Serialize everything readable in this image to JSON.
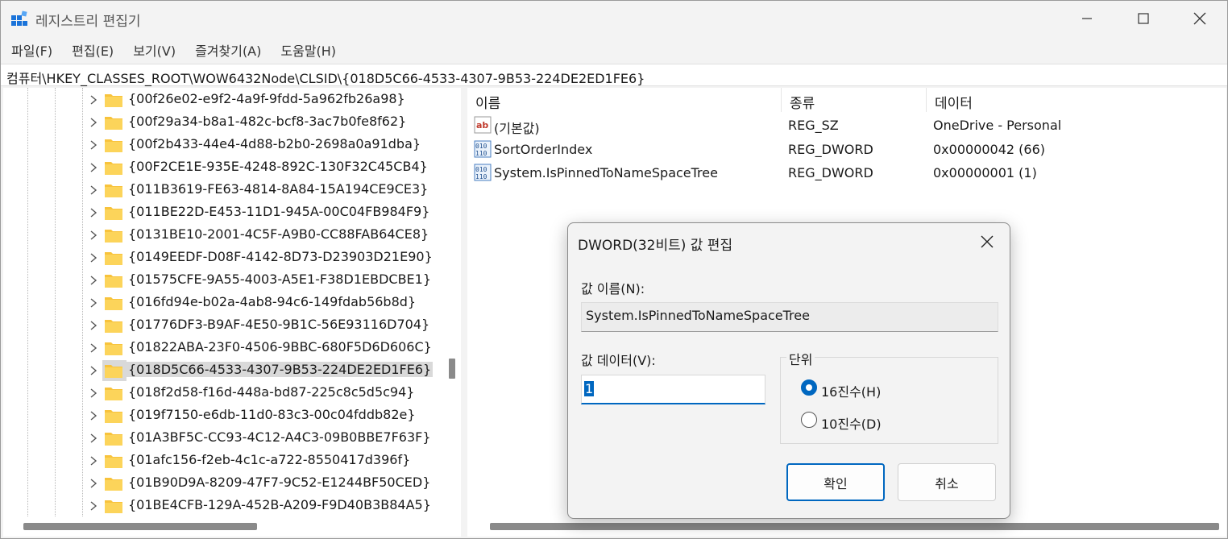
{
  "window": {
    "title": "레지스트리 편집기"
  },
  "menu": [
    "파일(F)",
    "편집(E)",
    "보기(V)",
    "즐겨찾기(A)",
    "도움말(H)"
  ],
  "address": "컴퓨터\\HKEY_CLASSES_ROOT\\WOW6432Node\\CLSID\\{018D5C66-4533-4307-9B53-224DE2ED1FE6}",
  "tree": {
    "items": [
      "{00f26e02-e9f2-4a9f-9fdd-5a962fb26a98}",
      "{00f29a34-b8a1-482c-bcf8-3ac7b0fe8f62}",
      "{00f2b433-44e4-4d88-b2b0-2698a0a91dba}",
      "{00F2CE1E-935E-4248-892C-130F32C45CB4}",
      "{011B3619-FE63-4814-8A84-15A194CE9CE3}",
      "{011BE22D-E453-11D1-945A-00C04FB984F9}",
      "{0131BE10-2001-4C5F-A9B0-CC88FAB64CE8}",
      "{0149EEDF-D08F-4142-8D73-D23903D21E90}",
      "{01575CFE-9A55-4003-A5E1-F38D1EBDCBE1}",
      "{016fd94e-b02a-4ab8-94c6-149fdab56b8d}",
      "{01776DF3-B9AF-4E50-9B1C-56E93116D704}",
      "{01822ABA-23F0-4506-9BBC-680F5D6D606C}",
      "{018D5C66-4533-4307-9B53-224DE2ED1FE6}",
      "{018f2d58-f16d-448a-bd87-225c8c5d5c94}",
      "{019f7150-e6db-11d0-83c3-00c04fddb82e}",
      "{01A3BF5C-CC93-4C12-A4C3-09B0BBE7F63F}",
      "{01afc156-f2eb-4c1c-a722-8550417d396f}",
      "{01B90D9A-8209-47F7-9C52-E1244BF50CED}",
      "{01BE4CFB-129A-452B-A209-F9D40B3B84A5}"
    ],
    "selected_index": 12
  },
  "values": {
    "headers": {
      "name": "이름",
      "type": "종류",
      "data": "데이터"
    },
    "rows": [
      {
        "icon": "string-value-icon",
        "name": "(기본값)",
        "type": "REG_SZ",
        "data": "OneDrive - Personal"
      },
      {
        "icon": "binary-value-icon",
        "name": "SortOrderIndex",
        "type": "REG_DWORD",
        "data": "0x00000042 (66)"
      },
      {
        "icon": "binary-value-icon",
        "name": "System.IsPinnedToNameSpaceTree",
        "type": "REG_DWORD",
        "data": "0x00000001 (1)"
      }
    ]
  },
  "dialog": {
    "title": "DWORD(32비트) 값 편집",
    "name_label": "값 이름(N):",
    "name_value": "System.IsPinnedToNameSpaceTree",
    "data_label": "값 데이터(V):",
    "data_value": "1",
    "base_label": "단위",
    "radio_hex": "16진수(H)",
    "radio_dec": "10진수(D)",
    "selected_base": "hex",
    "ok": "확인",
    "cancel": "취소"
  },
  "colors": {
    "accent": "#0067c0",
    "folder": "#f8c33c",
    "selection": "#d9d9d9"
  }
}
